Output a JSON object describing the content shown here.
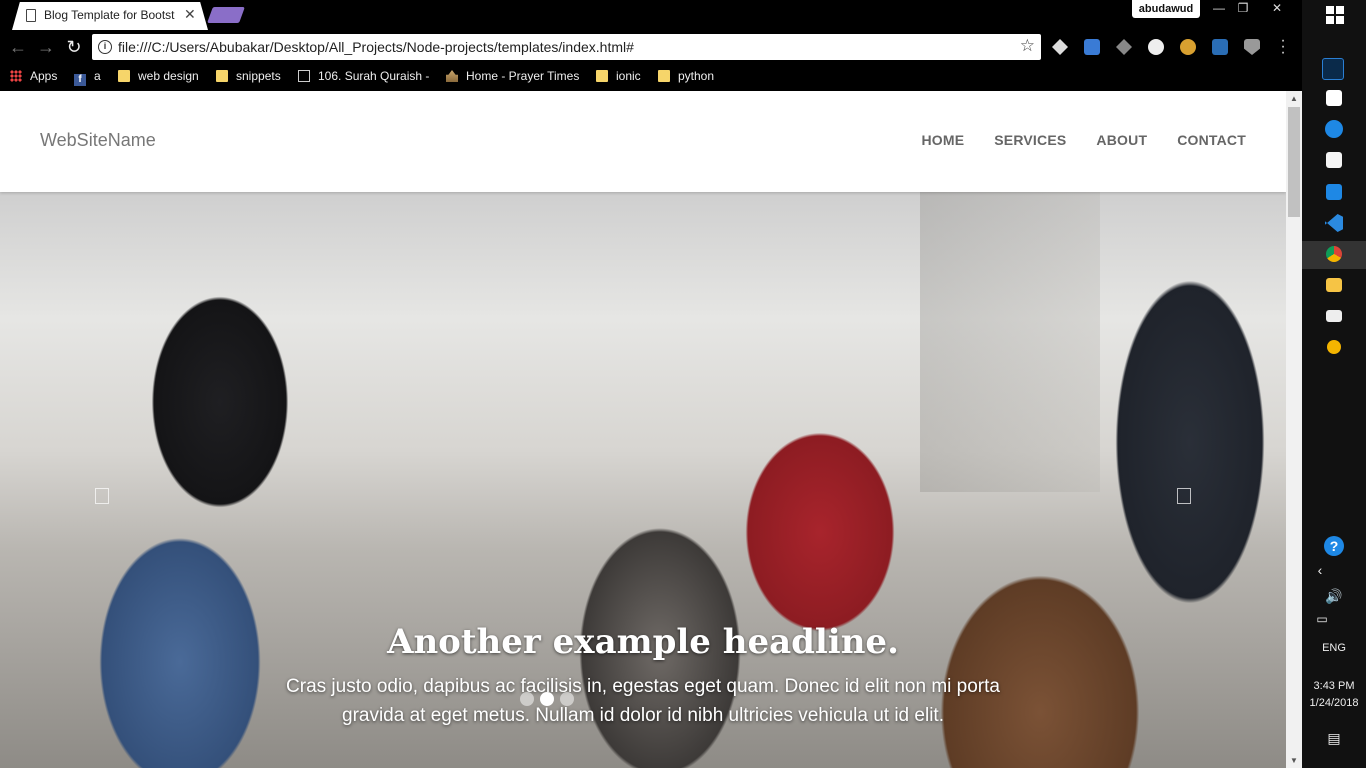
{
  "browser": {
    "tab_title": "Blog Template for Bootst",
    "user": "abudawud",
    "url": "file:///C:/Users/Abubakar/Desktop/All_Projects/Node-projects/templates/index.html#",
    "bookmarks": [
      {
        "label": "Apps",
        "icon": "apps-grid-icon"
      },
      {
        "label": "a",
        "icon": "facebook-icon"
      },
      {
        "label": "web design",
        "icon": "folder-icon"
      },
      {
        "label": "snippets",
        "icon": "folder-icon"
      },
      {
        "label": "106. Surah Quraish -",
        "icon": "page-icon"
      },
      {
        "label": "Home - Prayer Times",
        "icon": "mosque-icon"
      },
      {
        "label": "ionic",
        "icon": "folder-icon"
      },
      {
        "label": "python",
        "icon": "folder-icon"
      }
    ]
  },
  "site": {
    "brand": "WebSiteName",
    "nav": [
      "HOME",
      "SERVICES",
      "ABOUT",
      "CONTACT"
    ],
    "carousel": {
      "headline": "Another example headline.",
      "text": "Cras justo odio, dapibus ac facilisis in, egestas eget quam. Donec id elit non mi porta gravida at eget metus. Nullam id dolor id nibh ultricies vehicula ut id elit.",
      "slides": 3,
      "active_slide": 2
    }
  },
  "taskbar": {
    "language": "ENG",
    "time": "3:43 PM",
    "date": "1/24/2018"
  },
  "colors": {
    "nav_text": "#666666",
    "brand_text": "#777777",
    "chrome_bg": "#000000",
    "taskbar_bg": "#111111"
  }
}
